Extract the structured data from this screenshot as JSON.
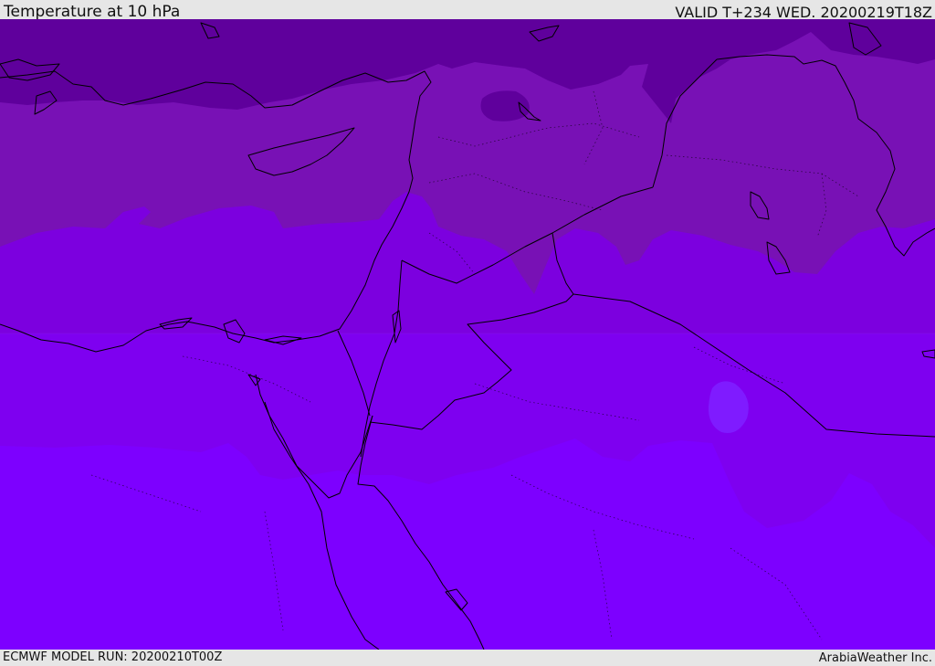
{
  "header": {
    "title": "Temperature at 10 hPa",
    "valid": "VALID T+234 WED. 20200219T18Z"
  },
  "footer": {
    "model_run": "ECMWF MODEL RUN: 20200210T00Z",
    "credit": "ArabiaWeather Inc."
  },
  "colors": {
    "band_coldest": "#5f009c",
    "band_2": "#7811b5",
    "band_3": "#7c00df",
    "band_4": "#7e00f0",
    "band_warmest": "#7d00ff",
    "patch_warm": "#7f1bff",
    "coastline": "#000000",
    "frame": "#e6e6e6"
  }
}
